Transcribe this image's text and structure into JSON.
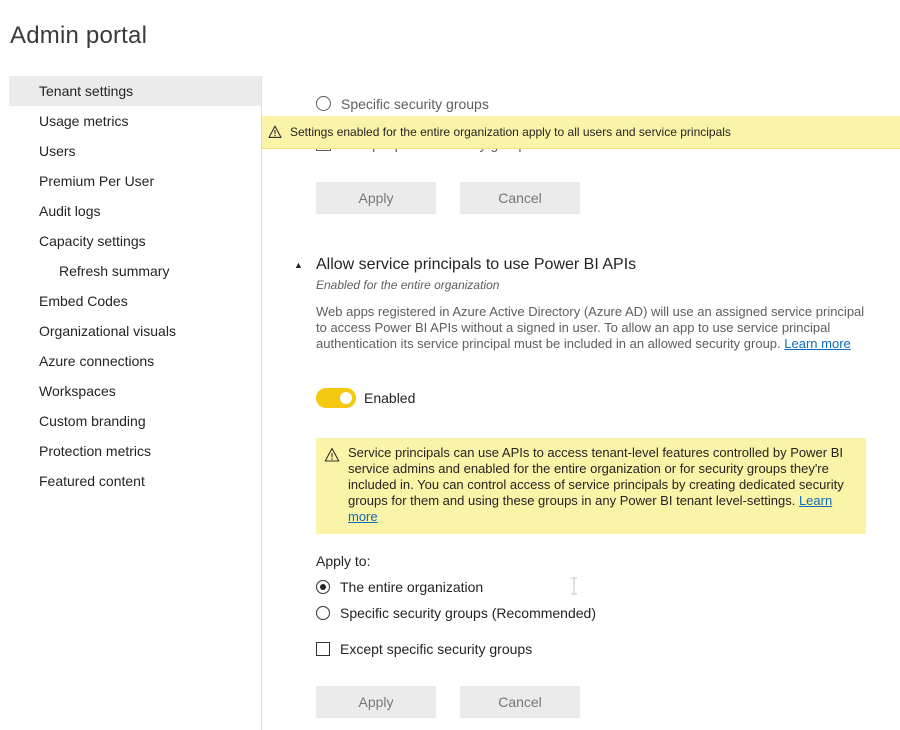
{
  "page": {
    "title": "Admin portal"
  },
  "sidebar": {
    "items": [
      {
        "label": "Tenant settings",
        "selected": true
      },
      {
        "label": "Usage metrics"
      },
      {
        "label": "Users"
      },
      {
        "label": "Premium Per User"
      },
      {
        "label": "Audit logs"
      },
      {
        "label": "Capacity settings"
      },
      {
        "label": "Refresh summary",
        "sub": true
      },
      {
        "label": "Embed Codes"
      },
      {
        "label": "Organizational visuals"
      },
      {
        "label": "Azure connections"
      },
      {
        "label": "Workspaces"
      },
      {
        "label": "Custom branding"
      },
      {
        "label": "Protection metrics"
      },
      {
        "label": "Featured content"
      }
    ]
  },
  "top": {
    "partial_radio_label": "Specific security groups",
    "partial_check_label": "Except specific security groups",
    "banner": "Settings enabled for the entire organization apply to all users and service principals",
    "apply_label": "Apply",
    "cancel_label": "Cancel"
  },
  "section": {
    "title": "Allow service principals to use Power BI APIs",
    "subtitle": "Enabled for the entire organization",
    "description": "Web apps registered in Azure Active Directory (Azure AD) will use an assigned service principal to access Power BI APIs without a signed in user. To allow an app to use service principal authentication its service principal must be included in an allowed security group.",
    "learn_more": "Learn more",
    "toggle": {
      "label": "Enabled",
      "on": true
    },
    "info": {
      "text": "Service principals can use APIs to access tenant-level features controlled by Power BI service admins and enabled for the entire organization or for security groups they're included in. You can control access of service principals by creating dedicated security groups for them and using these groups in any Power BI tenant level-settings.",
      "learn_more": "Learn more"
    },
    "apply_to": {
      "label": "Apply to:",
      "options": [
        {
          "label": "The entire organization",
          "selected": true
        },
        {
          "label": "Specific security groups (Recommended)",
          "selected": false
        }
      ],
      "except_label": "Except specific security groups",
      "except_checked": false
    },
    "apply_label": "Apply",
    "cancel_label": "Cancel"
  },
  "colors": {
    "banner_bg": "#fbf3a7",
    "toggle_on": "#f2c811",
    "link": "#0f6cbd"
  }
}
